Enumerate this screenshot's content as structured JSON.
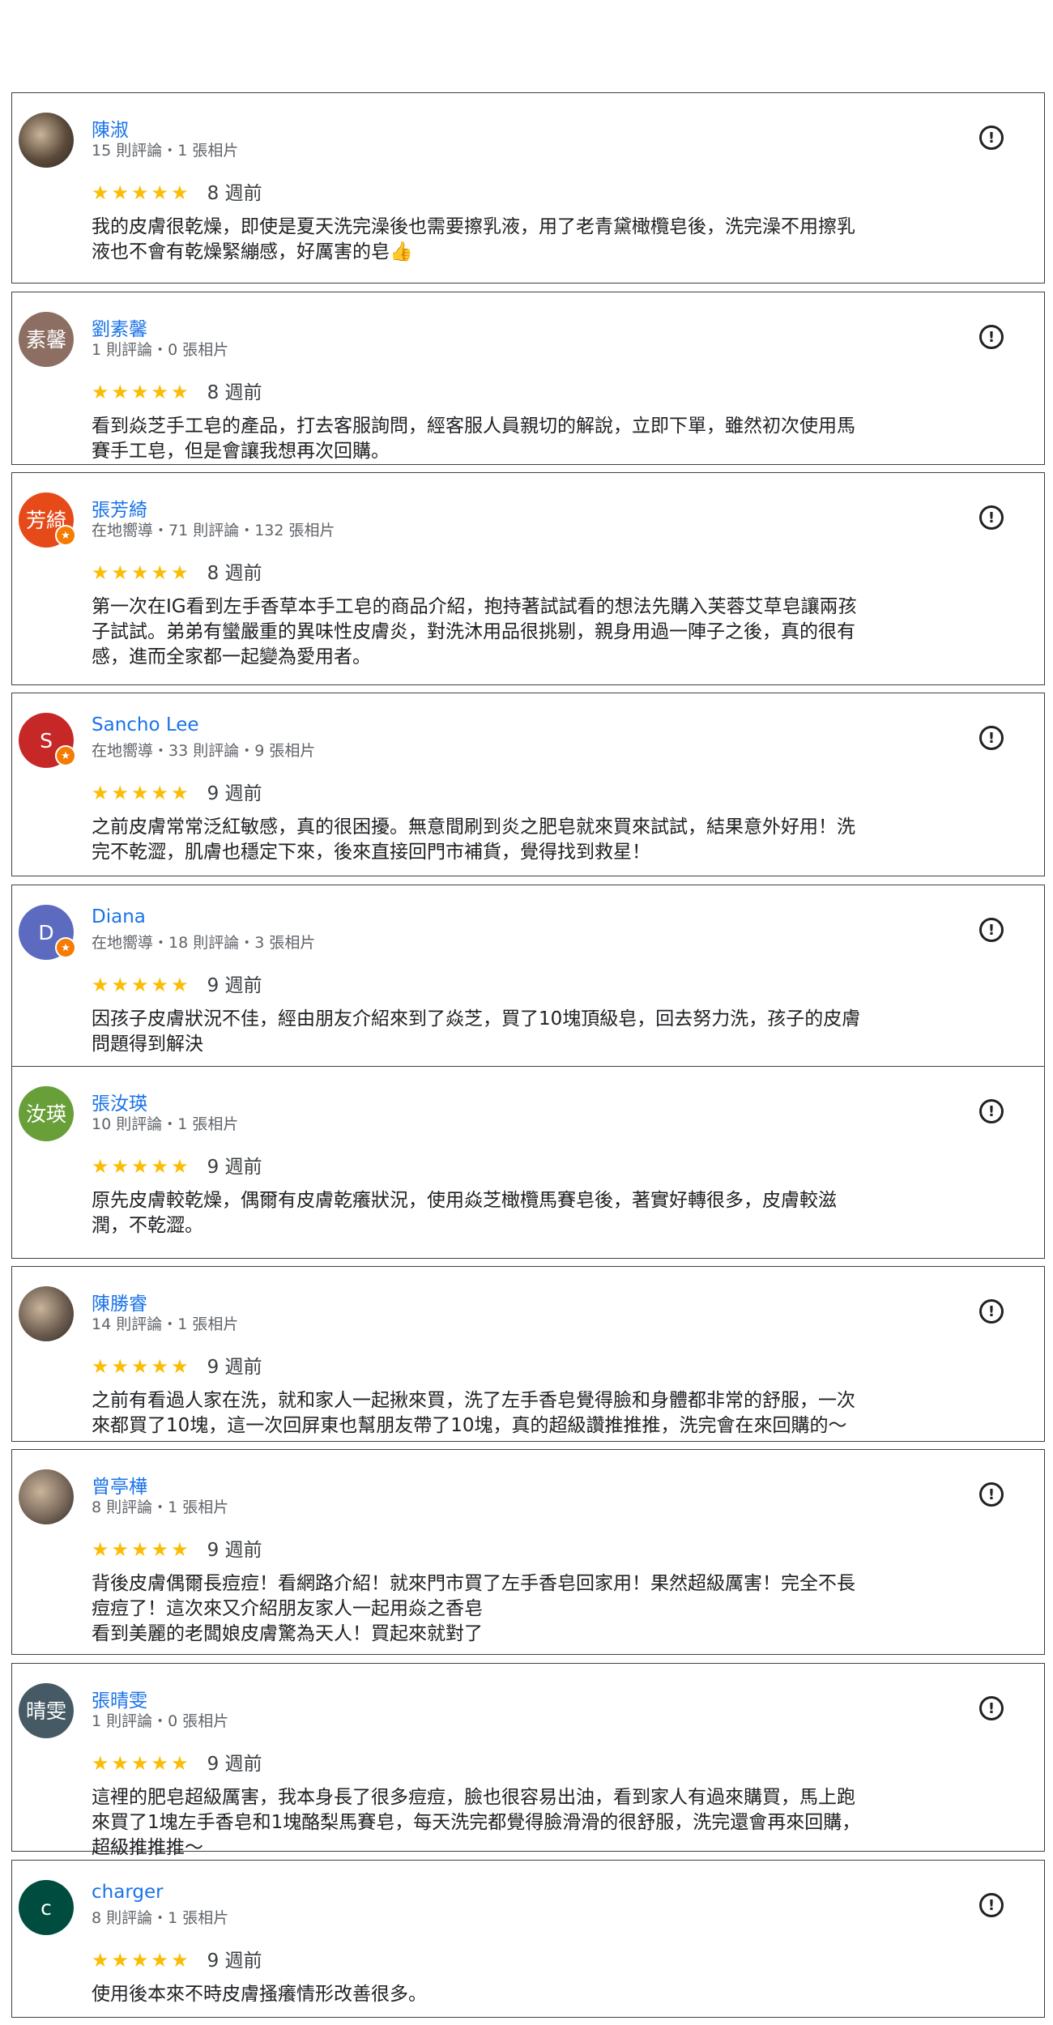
{
  "reviews": [
    {
      "name": "陳淑",
      "meta": "15 則評論・1 張相片",
      "stars": "★★★★★",
      "time": "8 週前",
      "text": "我的皮膚很乾燥，即使是夏天洗完澡後也需要擦乳液，用了老青黛橄欖皂後，洗完澡不用擦乳\n液也不會有乾燥緊繃感，好厲害的皂👍",
      "avatar": {
        "type": "photo",
        "text": "",
        "color": "#5b4a3a",
        "badge": false
      }
    },
    {
      "name": "劉素馨",
      "meta": "1 則評論・0 張相片",
      "stars": "★★★★★",
      "time": "8 週前",
      "text": "看到焱芝手工皂的產品，打去客服詢問，經客服人員親切的解說，立即下單，雖然初次使用馬\n賽手工皂，但是會讓我想再次回購。",
      "avatar": {
        "type": "text",
        "text": "素馨",
        "color": "#8d6e63",
        "badge": false
      }
    },
    {
      "name": "張芳綺",
      "meta": "在地嚮導・71 則評論・132 張相片",
      "stars": "★★★★★",
      "time": "8 週前",
      "text": "第一次在IG看到左手香草本手工皂的商品介紹，抱持著試試看的想法先購入芙蓉艾草皂讓兩孩\n子試試。弟弟有蠻嚴重的異味性皮膚炎，對洗沐用品很挑剔，親身用過一陣子之後，真的很有\n感，進而全家都一起變為愛用者。",
      "avatar": {
        "type": "text",
        "text": "芳綺",
        "color": "#e64a19",
        "badge": true
      }
    },
    {
      "name": "Sancho Lee",
      "meta": "在地嚮導・33 則評論・9 張相片",
      "stars": "★★★★★",
      "time": "9 週前",
      "text": "之前皮膚常常泛紅敏感，真的很困擾。無意間刷到炎之肥皂就來買來試試，結果意外好用！洗\n完不乾澀，肌膚也穩定下來，後來直接回門市補貨，覺得找到救星！",
      "avatar": {
        "type": "text",
        "text": "S",
        "color": "#c62828",
        "badge": true
      }
    },
    {
      "name": "Diana",
      "meta": "在地嚮導・18 則評論・3 張相片",
      "stars": "★★★★★",
      "time": "9 週前",
      "text": "因孩子皮膚狀況不佳，經由朋友介紹來到了焱芝，買了10塊頂級皂，回去努力洗，孩子的皮膚\n問題得到解決",
      "avatar": {
        "type": "text",
        "text": "D",
        "color": "#5c6bc0",
        "badge": true
      }
    },
    {
      "name": "張汝瑛",
      "meta": "10 則評論・1 張相片",
      "stars": "★★★★★",
      "time": "9 週前",
      "text": "原先皮膚較乾燥，偶爾有皮膚乾癢狀況，使用焱芝橄欖馬賽皂後，著實好轉很多，皮膚較滋\n潤，不乾澀。",
      "avatar": {
        "type": "text",
        "text": "汝瑛",
        "color": "#689f38",
        "badge": false
      }
    },
    {
      "name": "陳勝睿",
      "meta": "14 則評論・1 張相片",
      "stars": "★★★★★",
      "time": "9 週前",
      "text": "之前有看過人家在洗，就和家人一起揪來買，洗了左手香皂覺得臉和身體都非常的舒服，一次\n來都買了10塊，這一次回屏東也幫朋友帶了10塊，真的超級讚推推推，洗完會在來回購的〜",
      "avatar": {
        "type": "photo",
        "text": "",
        "color": "#6d5d50",
        "badge": false
      }
    },
    {
      "name": "曾亭樺",
      "meta": "8 則評論・1 張相片",
      "stars": "★★★★★",
      "time": "9 週前",
      "text": "背後皮膚偶爾長痘痘！看網路介紹！就來門市買了左手香皂回家用！果然超級厲害！完全不長\n痘痘了！這次來又介紹朋友家人一起用焱之香皂\n看到美麗的老闆娘皮膚驚為天人！買起來就對了",
      "avatar": {
        "type": "photo",
        "text": "",
        "color": "#7b6a5c",
        "badge": false
      }
    },
    {
      "name": "張晴雯",
      "meta": "1 則評論・0 張相片",
      "stars": "★★★★★",
      "time": "9 週前",
      "text": "這裡的肥皂超級厲害，我本身長了很多痘痘，臉也很容易出油，看到家人有過來購買，馬上跑\n來買了1塊左手香皂和1塊酪梨馬賽皂，每天洗完都覺得臉滑滑的很舒服，洗完還會再來回購，\n超級推推推〜",
      "avatar": {
        "type": "text",
        "text": "晴雯",
        "color": "#455a64",
        "badge": false
      }
    },
    {
      "name": "charger",
      "meta": "8 則評論・1 張相片",
      "stars": "★★★★★",
      "time": "9 週前",
      "text": "使用後本來不時皮膚搔癢情形改善很多。",
      "avatar": {
        "type": "text",
        "text": "c",
        "color": "#004d40",
        "badge": false
      }
    }
  ],
  "icons": {
    "flag": "report-flag-icon",
    "badge": "local-guide-star-icon"
  },
  "colors": {
    "name": "#1a73e8",
    "star": "#fbbc04",
    "border": "#3c4043"
  }
}
